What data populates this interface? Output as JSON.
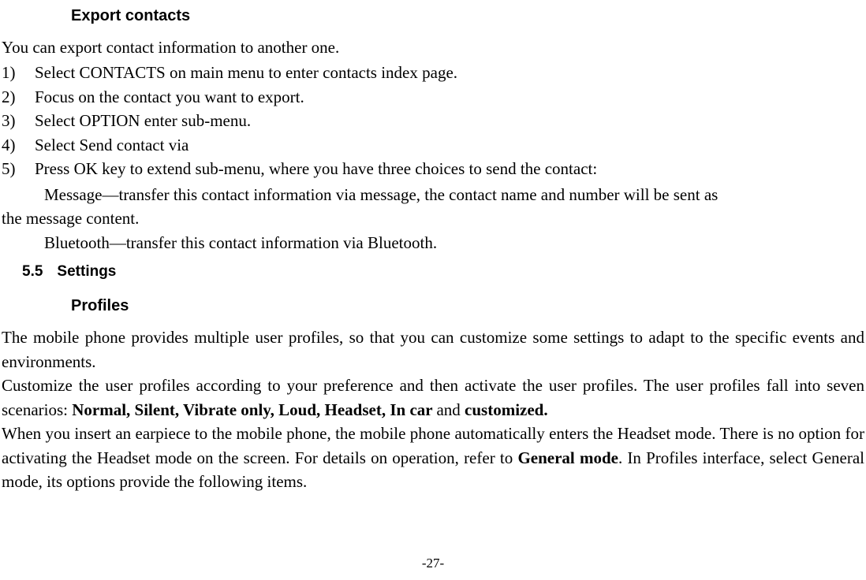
{
  "heading1": "Export contacts",
  "intro": "You can export contact information to another one.",
  "steps": [
    {
      "num": "1)",
      "text": "Select CONTACTS on main menu to enter contacts index page."
    },
    {
      "num": "2)",
      "text": "Focus on the contact you want to export."
    },
    {
      "num": "3)",
      "text": "Select OPTION enter sub-menu."
    },
    {
      "num": "4)",
      "text": "Select Send contact via"
    },
    {
      "num": "5)",
      "text": "Press OK key to extend sub-menu, where you have three choices to send the contact:"
    }
  ],
  "sub1a": "Message—transfer this contact information via message, the contact name and number will be sent as",
  "sub1b": "the message content.",
  "sub2": "Bluetooth—transfer this contact information via Bluetooth.",
  "section": {
    "num": "5.5",
    "title": "Settings"
  },
  "heading2": "Profiles",
  "profiles": {
    "p1": "The mobile phone provides multiple user profiles, so that you can customize some settings to adapt to the specific events and environments.",
    "p2a": "Customize the user profiles according to your preference and then activate the user profiles. The user profiles fall into seven scenarios: ",
    "p2b": "Normal, Silent, Vibrate only, Loud, Headset, In car ",
    "p2c": "and ",
    "p2d": "customized.",
    "p3a": "When you insert an earpiece to the mobile phone, the mobile phone automatically enters the Headset mode. There is no option for activating the Headset mode on the screen. For details on operation, refer to ",
    "p3b": "General mode",
    "p3c": ". In Profiles interface, select General mode, its options provide the following items."
  },
  "page": "-27-"
}
